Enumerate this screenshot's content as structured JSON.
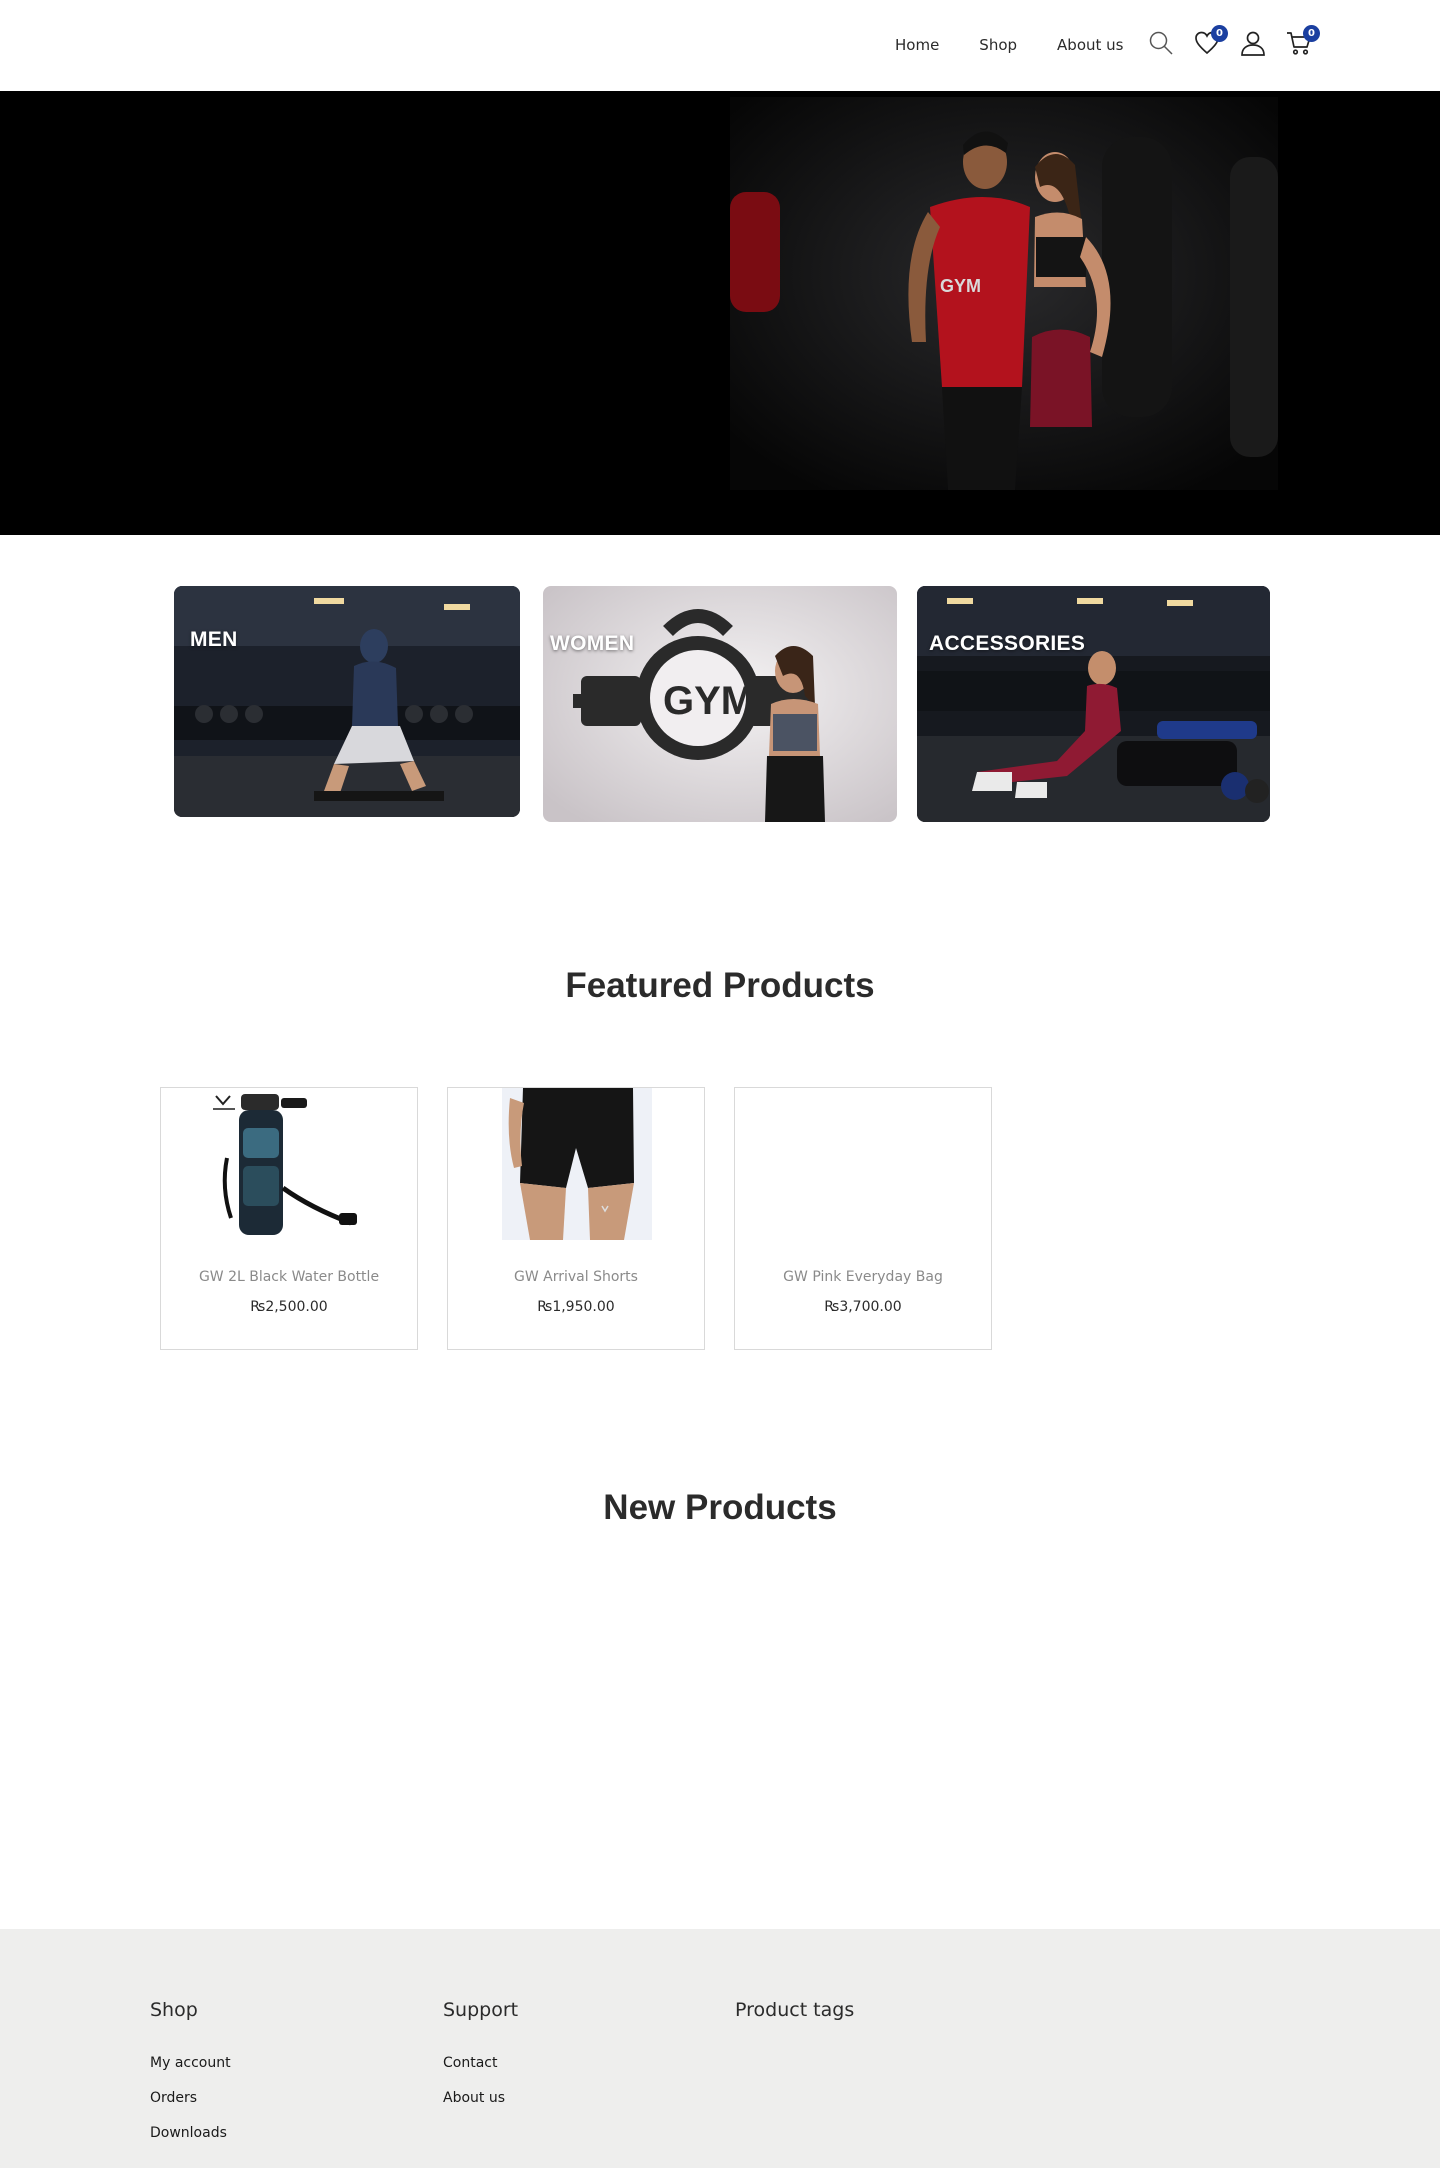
{
  "nav": {
    "items": [
      "Home",
      "Shop",
      "About us"
    ]
  },
  "header": {
    "wishlist_count": "0",
    "cart_count": "0"
  },
  "hero": {
    "shirt_text": "GYM"
  },
  "categories": [
    {
      "label": "MEN"
    },
    {
      "label": "WOMEN"
    },
    {
      "label": "ACCESSORIES"
    }
  ],
  "women_card": {
    "sign_text": "GYM"
  },
  "featured": {
    "title": "Featured Products",
    "products": [
      {
        "name": "GW 2L Black Water Bottle",
        "price": "₨2,500.00"
      },
      {
        "name": "GW Arrival Shorts",
        "price": "₨1,950.00"
      },
      {
        "name": "GW Pink Everyday Bag",
        "price": "₨3,700.00"
      }
    ]
  },
  "new_products": {
    "title": "New Products"
  },
  "footer": {
    "shop": {
      "title": "Shop",
      "links": [
        "My account",
        "Orders",
        "Downloads"
      ]
    },
    "support": {
      "title": "Support",
      "links": [
        "Contact",
        "About us"
      ]
    },
    "tags": {
      "title": "Product tags"
    }
  }
}
